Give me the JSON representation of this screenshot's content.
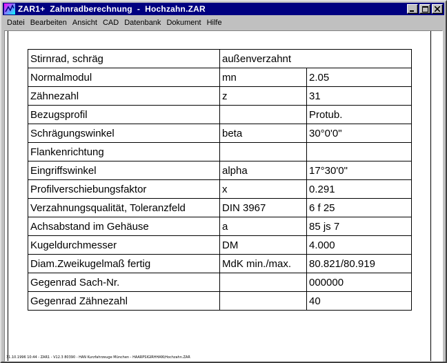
{
  "window": {
    "title": "ZAR1+  Zahnradberechnung  -  Hochzahn.ZAR",
    "icon": "gear-app-icon",
    "title_bar_color": "#000080"
  },
  "menu": [
    "Datei",
    "Bearbeiten",
    "Ansicht",
    "CAD",
    "Datenbank",
    "Dokument",
    "Hilfe"
  ],
  "table": {
    "header_row": {
      "label": "Stirnrad, schräg",
      "value": "außenverzahnt"
    },
    "rows": [
      {
        "label": "Normalmodul",
        "symbol": "mn",
        "value": "2.05"
      },
      {
        "label": "Zähnezahl",
        "symbol": "z",
        "value": "31"
      },
      {
        "label": "Bezugsprofil",
        "symbol": "",
        "value": "Protub."
      },
      {
        "label": "Schrägungswinkel",
        "symbol": "beta",
        "value": "30°0'0\""
      },
      {
        "label": "Flankenrichtung",
        "symbol": "",
        "value": ""
      },
      {
        "label": "Eingriffswinkel",
        "symbol": "alpha",
        "value": "17°30'0\""
      },
      {
        "label": "Profilverschiebungsfaktor",
        "symbol": "x",
        "value": "0.291"
      },
      {
        "label": "Verzahnungsqualität, Toleranzfeld",
        "symbol": "DIN 3967",
        "value": " 6 f 25"
      },
      {
        "label": "Achsabstand im Gehäuse",
        "symbol": "a",
        "value": "85 js 7"
      },
      {
        "label": "Kugeldurchmesser",
        "symbol": "DM",
        "value": "4.000"
      },
      {
        "label": "Diam.Zweikugelmaß fertig",
        "symbol": "MdK min./max.",
        "value": "80.821/80.919"
      },
      {
        "label": "Gegenrad Sach-Nr.",
        "symbol": "",
        "value": "000000"
      },
      {
        "label": "Gegenrad Zähnezahl",
        "symbol": "",
        "value": "40"
      }
    ]
  },
  "footer": "31.10.1996 10:44 - ZAR1 - V12.3 80390 - HAN Kurzfahrzeuge  München - HAARPSIGIRHHAN\\Hochzahn.ZAR"
}
